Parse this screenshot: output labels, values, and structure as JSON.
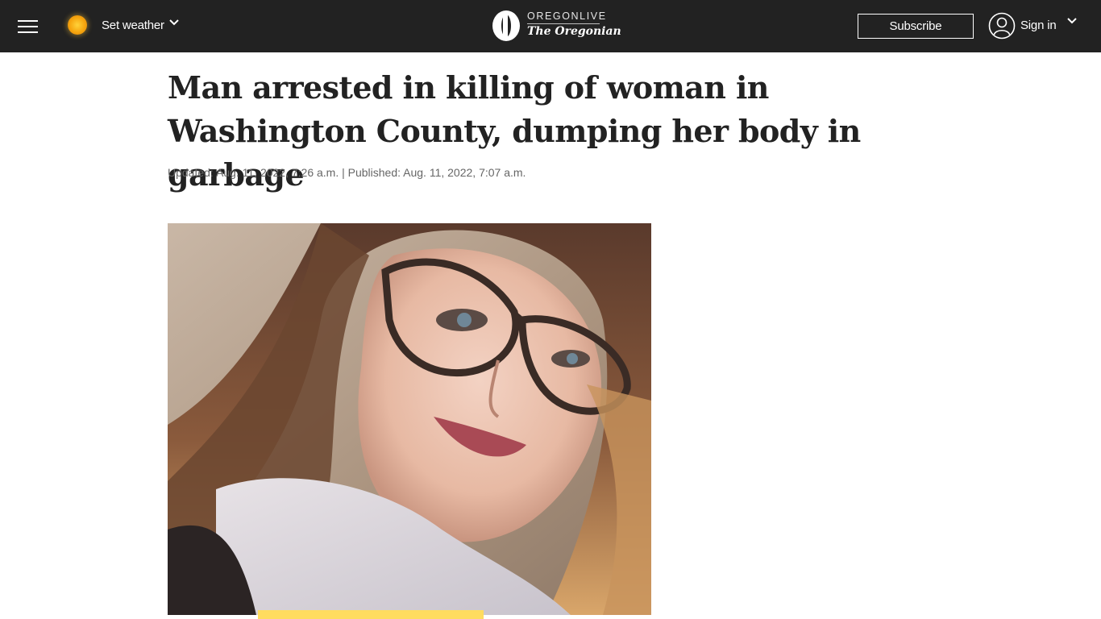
{
  "header": {
    "menu_icon": "hamburger-menu-icon",
    "weather": {
      "label": "Set weather",
      "icon": "sun-icon"
    },
    "logo": {
      "top": "OREGONLIVE",
      "bottom": "The Oregonian",
      "icon": "oregonian-o-logo"
    },
    "subscribe_label": "Subscribe",
    "signin_label": "Sign in",
    "user_icon": "user-circle-icon"
  },
  "article": {
    "headline": "Man arrested in killing of woman in Washington County, dumping her body in garbage",
    "dateline": "Updated: Aug. 11, 2022, 7:26 a.m. | Published: Aug. 11, 2022, 7:07 a.m.",
    "photo_description": "portrait photo"
  },
  "colors": {
    "nav_bg": "#222222",
    "headline": "#222222",
    "dateline": "#666666",
    "accent_yellow": "#ffdc5f"
  }
}
